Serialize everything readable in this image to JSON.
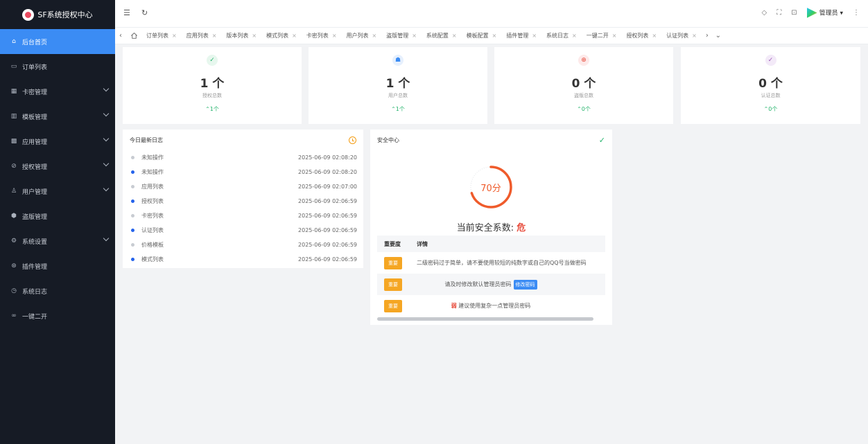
{
  "app": {
    "title": "SF系统授权中心"
  },
  "sidebar": {
    "items": [
      {
        "label": "后台首页",
        "icon": "home-icon",
        "active": true,
        "expandable": false
      },
      {
        "label": "订单列表",
        "icon": "order-icon",
        "active": false,
        "expandable": false
      },
      {
        "label": "卡密管理",
        "icon": "card-icon",
        "active": false,
        "expandable": true
      },
      {
        "label": "模板管理",
        "icon": "template-icon",
        "active": false,
        "expandable": true
      },
      {
        "label": "应用管理",
        "icon": "app-icon",
        "active": false,
        "expandable": true
      },
      {
        "label": "授权管理",
        "icon": "shield-icon",
        "active": false,
        "expandable": true
      },
      {
        "label": "用户管理",
        "icon": "user-icon",
        "active": false,
        "expandable": true
      },
      {
        "label": "盗版管理",
        "icon": "piracy-icon",
        "active": false,
        "expandable": false
      },
      {
        "label": "系统设置",
        "icon": "gear-icon",
        "active": false,
        "expandable": true
      },
      {
        "label": "插件管理",
        "icon": "plugin-icon",
        "active": false,
        "expandable": false
      },
      {
        "label": "系统日志",
        "icon": "clock-icon",
        "active": false,
        "expandable": false
      },
      {
        "label": "一键二开",
        "icon": "link-icon",
        "active": false,
        "expandable": false
      }
    ]
  },
  "header": {
    "user": "管理员",
    "icons": [
      "tag-icon",
      "fullscreen-icon",
      "lock-icon",
      "avatar",
      "more-icon"
    ]
  },
  "tabs": [
    "订单列表",
    "应用列表",
    "版本列表",
    "模式列表",
    "卡密列表",
    "用户列表",
    "盗版管理",
    "系统配置",
    "模板配置",
    "插件管理",
    "系统日志",
    "一键二开",
    "授权列表",
    "认证列表"
  ],
  "stats": [
    {
      "value": "1 个",
      "label": "授权总数",
      "trend": "1个",
      "color": "#23b36b",
      "bg": "#e7f7ee",
      "icon": "shield-check-icon"
    },
    {
      "value": "1 个",
      "label": "用户总数",
      "trend": "1个",
      "color": "#3b8cf4",
      "bg": "#e6f0fd",
      "icon": "users-icon"
    },
    {
      "value": "0 个",
      "label": "盗版总数",
      "trend": "0个",
      "color": "#e74c3c",
      "bg": "#fdeaea",
      "icon": "globe-icon"
    },
    {
      "value": "0 个",
      "label": "认证总数",
      "trend": "0个",
      "color": "#9b59b6",
      "bg": "#f3eaf8",
      "icon": "verified-icon"
    }
  ],
  "log": {
    "title": "今日最新日志",
    "entries": [
      {
        "name": "未知操作",
        "time": "2025-06-09 02:08:20",
        "color": "#c8ccd2"
      },
      {
        "name": "未知操作",
        "time": "2025-06-09 02:08:20",
        "color": "#2563eb"
      },
      {
        "name": "应用列表",
        "time": "2025-06-09 02:07:00",
        "color": "#c8ccd2"
      },
      {
        "name": "授权列表",
        "time": "2025-06-09 02:06:59",
        "color": "#2563eb"
      },
      {
        "name": "卡密列表",
        "time": "2025-06-09 02:06:59",
        "color": "#c8ccd2"
      },
      {
        "name": "认证列表",
        "time": "2025-06-09 02:06:59",
        "color": "#2563eb"
      },
      {
        "name": "价格模板",
        "time": "2025-06-09 02:06:59",
        "color": "#c8ccd2"
      },
      {
        "name": "模式列表",
        "time": "2025-06-09 02:06:59",
        "color": "#2563eb"
      }
    ]
  },
  "security": {
    "title": "安全中心",
    "score": 70,
    "score_label": "70分",
    "level_label": "当前安全系数:",
    "level": "危",
    "head": {
      "importance": "重要度",
      "detail": "详情"
    },
    "rows": [
      {
        "badge": "重要",
        "text": "二级密码过于简单，请不要使用较短的纯数字或自己的QQ号当做密码"
      },
      {
        "badge": "重要",
        "text": "请及时修改默认管理员密码",
        "button": "修改密码"
      },
      {
        "badge": "重要",
        "prefix": "弱",
        "text": "建议使用复杂一点管理员密码"
      }
    ]
  },
  "colors": {
    "accent": "#3b8cf4",
    "sidebar": "#161b25",
    "warning": "#f5a623",
    "danger": "#e74c3c",
    "gauge": "#ef5b2b"
  }
}
